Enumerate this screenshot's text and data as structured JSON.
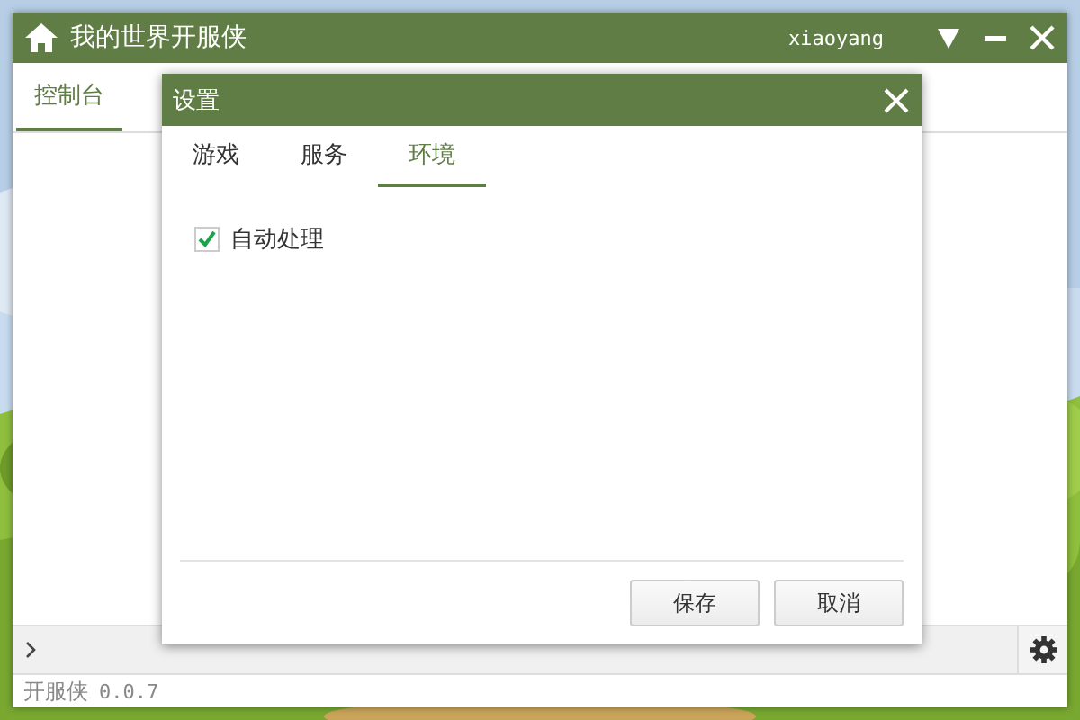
{
  "window": {
    "title": "我的世界开服侠",
    "user": "xiaoyang"
  },
  "tabs": [
    {
      "label": "控制台",
      "selected": true
    }
  ],
  "version": {
    "app": "开服侠",
    "number": "0.0.7"
  },
  "dialog": {
    "title": "设置",
    "tabs": [
      {
        "label": "游戏",
        "selected": false
      },
      {
        "label": "服务",
        "selected": false
      },
      {
        "label": "环境",
        "selected": true
      }
    ],
    "options": [
      {
        "label": "自动处理",
        "checked": true
      }
    ],
    "buttons": [
      "保存",
      "取消"
    ]
  }
}
